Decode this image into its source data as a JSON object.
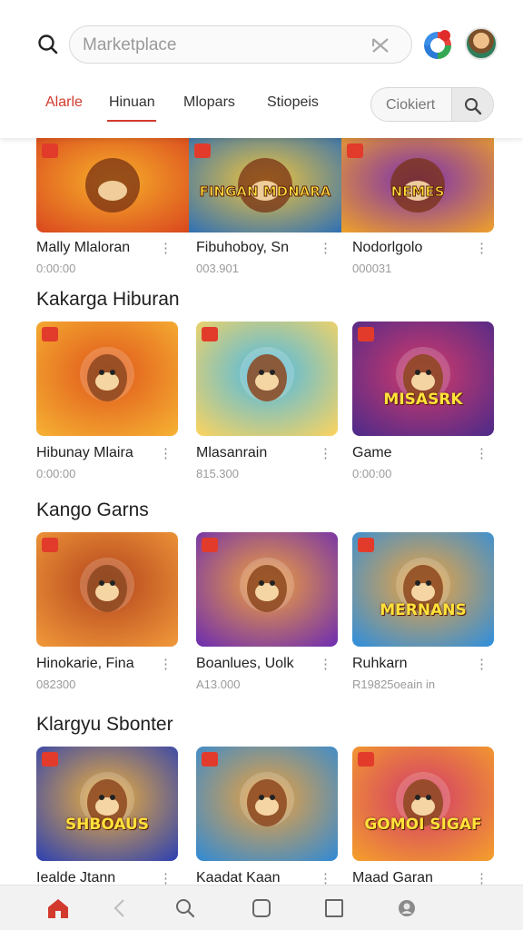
{
  "search": {
    "placeholder": "Marketplace"
  },
  "tabs": [
    {
      "label": "Alarle"
    },
    {
      "label": "Hinuan"
    },
    {
      "label": "Mlopars"
    },
    {
      "label": "Stiopeis"
    }
  ],
  "cookie_filter": {
    "label": "Ciokiert"
  },
  "featured": [
    {
      "title": "Mally Mlaloran",
      "sub": "0:00:00",
      "thumb_text": "",
      "colors": [
        "#f7b02a",
        "#d9461e"
      ]
    },
    {
      "title": "Fibuhoboy, Sn",
      "sub": "003.901",
      "thumb_text": "FINGAN MDNARA",
      "colors": [
        "#f3c53a",
        "#2d6fb6"
      ]
    },
    {
      "title": "Nodorlgolo",
      "sub": "000031",
      "thumb_text": "NEMES",
      "colors": [
        "#7a2fb0",
        "#f0a228"
      ]
    }
  ],
  "sections": [
    {
      "title": "Kakarga Hiburan",
      "cards": [
        {
          "title": "Hibunay Mlaira",
          "sub": "0:00:00",
          "thumb_text": "",
          "colors": [
            "#f6b333",
            "#e0561b"
          ]
        },
        {
          "title": "Mlasanrain",
          "sub": "815.300",
          "thumb_text": "",
          "colors": [
            "#ffd45c",
            "#49b9e8"
          ]
        },
        {
          "title": "Game",
          "sub": "0:00:00",
          "thumb_text": "MISASRK",
          "colors": [
            "#4a2a8a",
            "#d43a6a"
          ]
        }
      ]
    },
    {
      "title": "Kango Garns",
      "cards": [
        {
          "title": "Hinokarie, Fina",
          "sub": "082300",
          "thumb_text": "",
          "colors": [
            "#f29a3a",
            "#b3441d"
          ]
        },
        {
          "title": "Boanlues, Uolk",
          "sub": "A13.000",
          "thumb_text": "",
          "colors": [
            "#6b2ab3",
            "#f2a33a"
          ]
        },
        {
          "title": "Ruhkarn",
          "sub": "R19825oeain in",
          "thumb_text": "MERNANS",
          "colors": [
            "#2a8ee0",
            "#f3a33a"
          ]
        }
      ]
    },
    {
      "title": "Klargyu Sbonter",
      "cards": [
        {
          "title": "Iealde Jtann",
          "sub": "",
          "thumb_text": "SHBOAUS",
          "colors": [
            "#2a3fb3",
            "#f2b23a"
          ]
        },
        {
          "title": "Kaadat Kaan",
          "sub": "",
          "thumb_text": "",
          "colors": [
            "#2d8ad8",
            "#f0a13a"
          ]
        },
        {
          "title": "Maad Garan",
          "sub": "",
          "thumb_text": "GOMOI SIGAF",
          "colors": [
            "#f5a12a",
            "#d23a6a"
          ]
        }
      ]
    }
  ],
  "bottom_nav": [
    {
      "icon": "home-icon",
      "label": ""
    },
    {
      "icon": "back-icon"
    },
    {
      "icon": "search-icon"
    },
    {
      "icon": "square-icon"
    },
    {
      "icon": "recents-icon"
    },
    {
      "icon": "profile-icon"
    }
  ],
  "colors": {
    "accent": "#d23a2e",
    "text": "#222222",
    "muted": "#9a9a9a"
  }
}
